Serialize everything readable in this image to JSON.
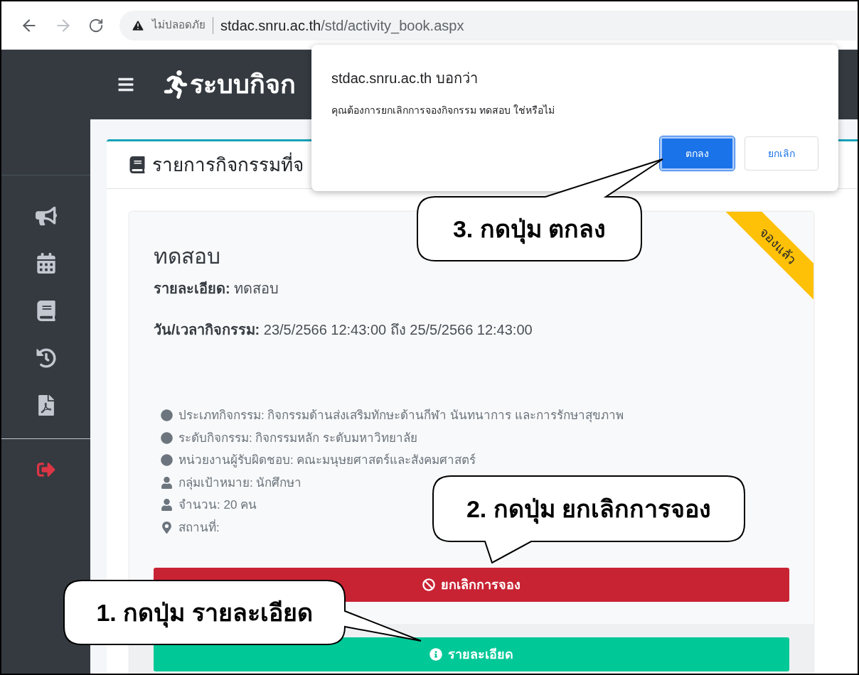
{
  "browser": {
    "security_label": "ไม่ปลอดภัย",
    "url_host": "stdac.snru.ac.th",
    "url_path": "/std/activity_book.aspx"
  },
  "header": {
    "logo_text": "ระบบกิจก"
  },
  "panel": {
    "title": "รายการกิจกรรมที่จ"
  },
  "activity": {
    "title": "ทดสอบ",
    "ribbon": "จองแล้ว",
    "details": [
      {
        "label": "รายละเอียด:",
        "value": "ทดสอบ"
      },
      {
        "label": "วัน/เวลากิจกรรม:",
        "value": "23/5/2566 12:43:00 ถึง 25/5/2566 12:43:00"
      }
    ],
    "info": [
      {
        "kind": "dot",
        "text": "ประเภทกิจกรรม: กิจกรรมด้านส่งเสริมทักษะด้านกีฬา นันทนาการ และการรักษาสุขภาพ"
      },
      {
        "kind": "dot",
        "text": "ระดับกิจกรรม: กิจกรรมหลัก ระดับมหาวิทยาลัย"
      },
      {
        "kind": "dot",
        "text": "หน่วยงานผู้รับผิดชอบ: คณะมนุษยศาสตร์และสังคมศาสตร์"
      },
      {
        "kind": "user",
        "text": "กลุ่มเป้าหมาย: นักศึกษา"
      },
      {
        "kind": "user",
        "text": "จำนวน: 20 คน"
      },
      {
        "kind": "location",
        "text": "สถานที่:"
      }
    ],
    "cancel_button": "ยกเลิกการจอง",
    "details_button": "รายละเอียด"
  },
  "dialog": {
    "title": "stdac.snru.ac.th บอกว่า",
    "message": "คุณต้องการยกเลิกการจองกิจกรรม ทดสอบ ใช่หรือไม่",
    "buttons": [
      {
        "label": "ตกลง",
        "kind": "primary"
      },
      {
        "label": "ยกเลิก",
        "kind": "secondary"
      }
    ]
  },
  "callouts": [
    {
      "text": "3. กดปุ่ม ตกลง"
    },
    {
      "text": "2. กดปุ่ม ยกเลิกการจอง"
    },
    {
      "text": "1. กดปุ่ม รายละเอียด"
    }
  ]
}
